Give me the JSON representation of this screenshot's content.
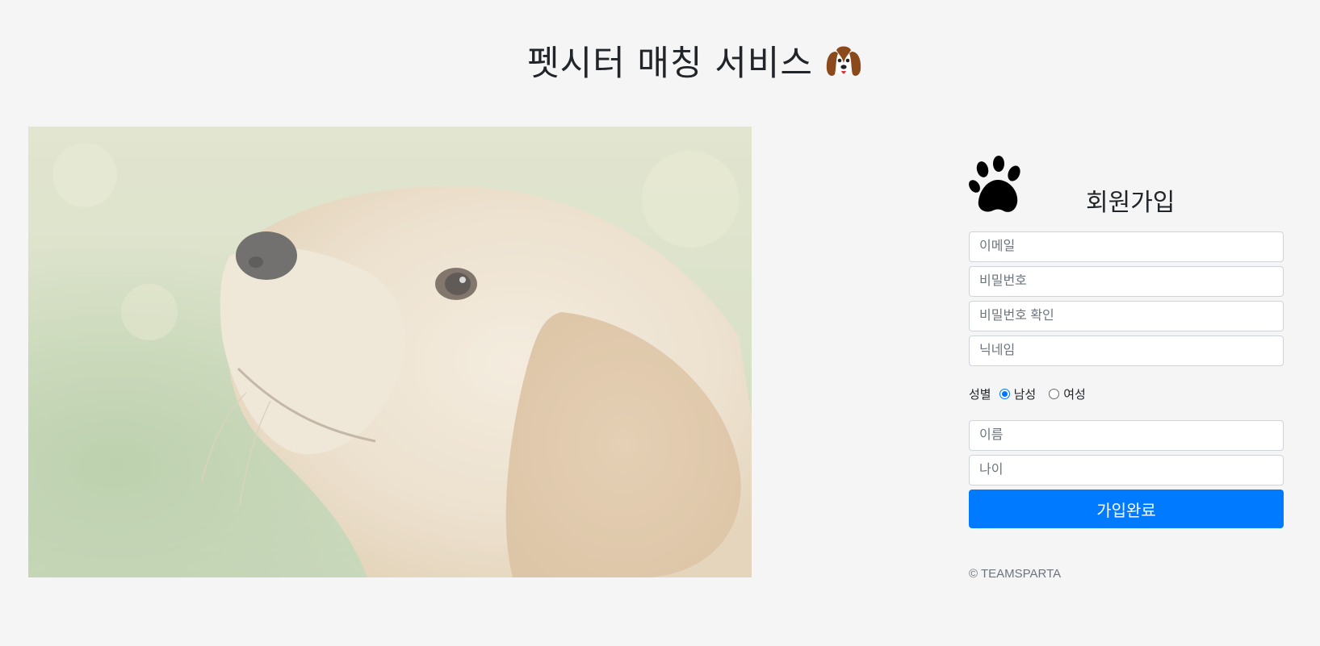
{
  "header": {
    "title": "펫시터 매칭 서비스",
    "title_icon": "dog-face-icon"
  },
  "hero": {
    "image": "golden-retriever-puppy-photo"
  },
  "form": {
    "icon": "paw-print-icon",
    "title": "회원가입",
    "email_placeholder": "이메일",
    "password_placeholder": "비밀번호",
    "password_confirm_placeholder": "비밀번호 확인",
    "nickname_placeholder": "닉네임",
    "gender": {
      "label": "성별",
      "options": [
        "남성",
        "여성"
      ],
      "selected": "남성"
    },
    "name_placeholder": "이름",
    "age_placeholder": "나이",
    "submit_label": "가입완료"
  },
  "footer": {
    "copyright": "© TEAMSPARTA"
  },
  "colors": {
    "background": "#f5f5f5",
    "primary": "#007bff",
    "radio_accent": "#0075ff"
  }
}
